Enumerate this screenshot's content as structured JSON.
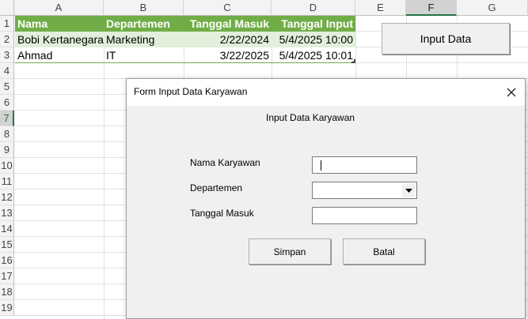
{
  "spreadsheet": {
    "columns": [
      "A",
      "B",
      "C",
      "D",
      "E",
      "F",
      "G"
    ],
    "selected_column": "F",
    "rows": [
      "1",
      "2",
      "3",
      "4",
      "5",
      "6",
      "7",
      "8",
      "9",
      "10",
      "11",
      "12",
      "13",
      "14",
      "15",
      "16",
      "17",
      "18",
      "19"
    ],
    "selected_row": "7",
    "header": [
      "Nama",
      "Departemen",
      "Tanggal Masuk",
      "Tanggal Input"
    ],
    "data": [
      [
        "Bobi Kertanegara",
        "Marketing",
        "2/22/2024",
        "5/4/2025 10:00"
      ],
      [
        "Ahmad",
        "IT",
        "3/22/2025",
        "5/4/2025 10:01"
      ]
    ],
    "colors": {
      "header_bg": "#70ad47",
      "band_bg": "#e2efda",
      "accent": "#217346"
    },
    "input_button_label": "Input Data"
  },
  "dialog": {
    "title": "Form Input Data Karyawan",
    "heading": "Input Data Karyawan",
    "fields": {
      "nama_label": "Nama Karyawan",
      "nama_value": "",
      "departemen_label": "Departemen",
      "departemen_value": "",
      "tanggal_label": "Tanggal Masuk",
      "tanggal_value": ""
    },
    "buttons": {
      "save": "Simpan",
      "cancel": "Batal"
    },
    "icons": {
      "close": "close-icon",
      "dropdown": "chevron-down-icon"
    }
  }
}
